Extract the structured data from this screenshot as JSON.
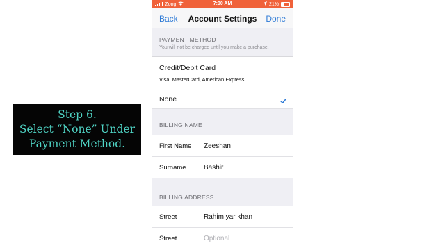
{
  "caption": {
    "line1": "Step 6.",
    "line2": "Select “None” Under",
    "line3": "Payment Method."
  },
  "status_bar": {
    "carrier": "Zong",
    "time": "7:00 AM",
    "battery": "21%",
    "background": "#f0623a"
  },
  "nav": {
    "back_label": "Back",
    "title": "Account Settings",
    "done_label": "Done",
    "accent": "#2f7bd6"
  },
  "payment": {
    "header": "PAYMENT METHOD",
    "subheader": "You will not be charged until you make a purchase.",
    "options": [
      {
        "label": "Credit/Debit Card",
        "sub": "Visa, MasterCard, American Express"
      },
      {
        "label": "None",
        "selected": true,
        "icon": "checkmark-icon"
      }
    ]
  },
  "billing_name": {
    "header": "BILLING NAME",
    "first_name_label": "First Name",
    "first_name_value": "Zeeshan",
    "surname_label": "Surname",
    "surname_value": "Bashir"
  },
  "billing_address": {
    "header": "BILLING ADDRESS",
    "street1_label": "Street",
    "street1_value": "Rahim yar khan",
    "street2_label": "Street",
    "street2_placeholder": "Optional"
  }
}
